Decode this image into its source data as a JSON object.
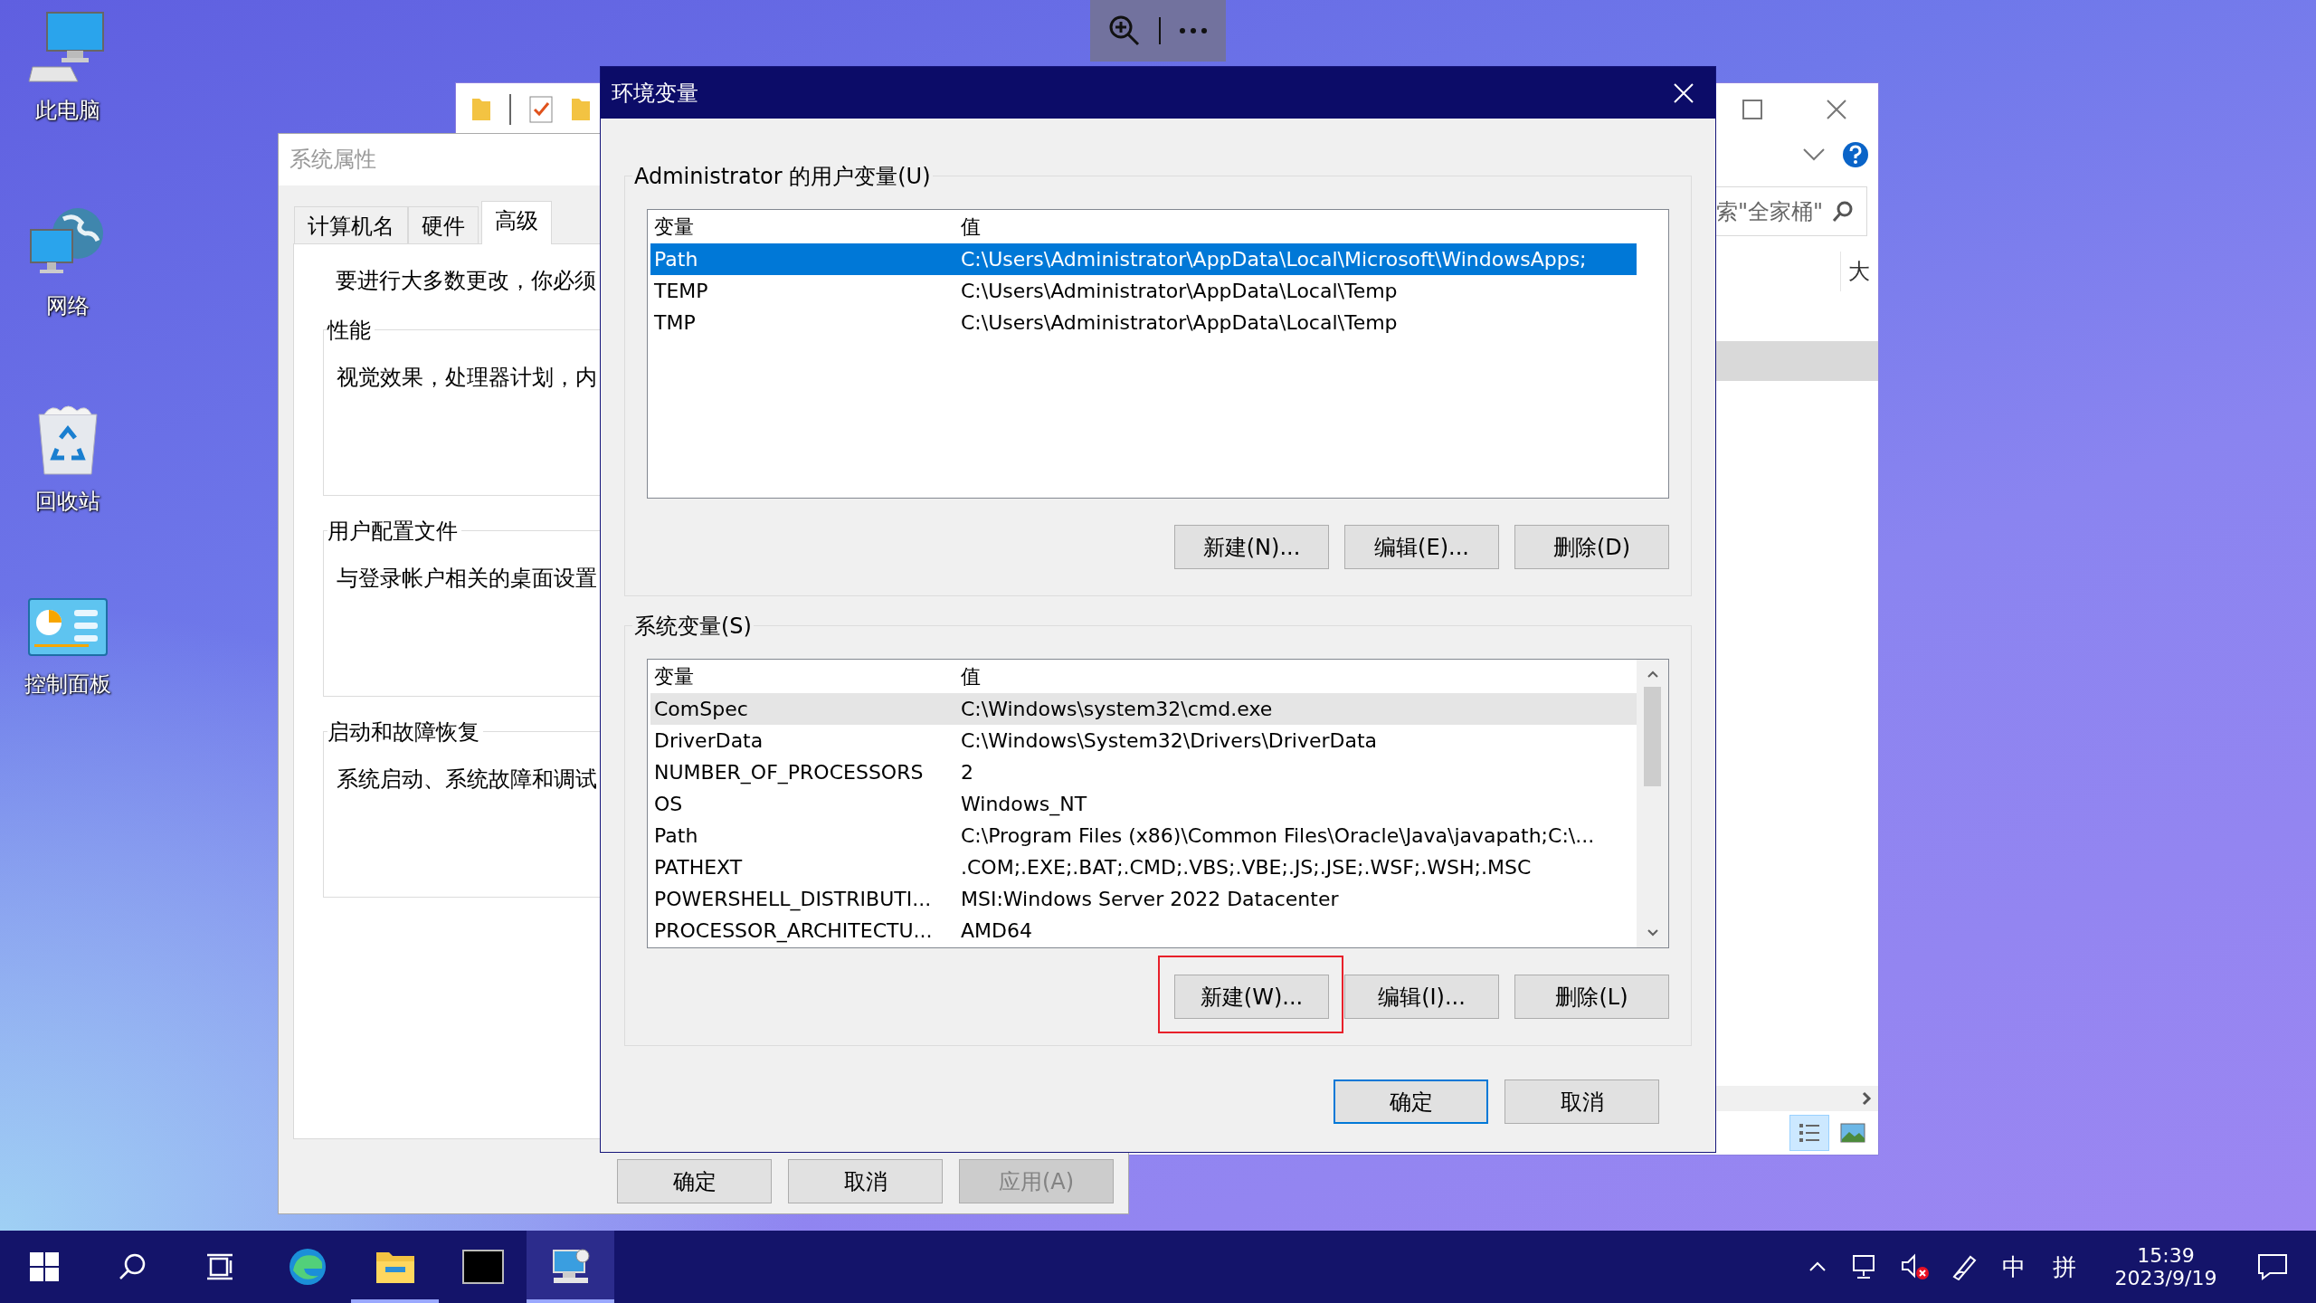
{
  "desktop_icons": [
    {
      "kind": "computer",
      "label": "此电脑"
    },
    {
      "kind": "network",
      "label": "网络"
    },
    {
      "kind": "recycle-bin",
      "label": "回收站"
    },
    {
      "kind": "control-panel",
      "label": "控制面板"
    }
  ],
  "explorer_window": {
    "search": {
      "placeholder": "索\"全家桶\""
    },
    "column_header": "大"
  },
  "system_properties": {
    "title": "系统属性",
    "tabs": [
      {
        "label": "计算机名",
        "selected": false
      },
      {
        "label": "硬件",
        "selected": false
      },
      {
        "label": "高级",
        "selected": true
      }
    ],
    "intro": "要进行大多数更改，你必须",
    "groups": [
      {
        "label": "性能",
        "text": "视觉效果，处理器计划，内"
      },
      {
        "label": "用户配置文件",
        "text": "与登录帐户相关的桌面设置"
      },
      {
        "label": "启动和故障恢复",
        "text": "系统启动、系统故障和调试"
      }
    ],
    "buttons": [
      {
        "label": "确定",
        "disabled": false
      },
      {
        "label": "取消",
        "disabled": false
      },
      {
        "label": "应用(A)",
        "disabled": true
      }
    ]
  },
  "env_dialog": {
    "title": "环境变量",
    "user_vars": {
      "label": "Administrator 的用户变量(U)",
      "focused": true,
      "columns": [
        "变量",
        "值"
      ],
      "rows": [
        {
          "name": "Path",
          "value": "C:\\Users\\Administrator\\AppData\\Local\\Microsoft\\WindowsApps;",
          "selected": true
        },
        {
          "name": "TEMP",
          "value": "C:\\Users\\Administrator\\AppData\\Local\\Temp",
          "selected": false
        },
        {
          "name": "TMP",
          "value": "C:\\Users\\Administrator\\AppData\\Local\\Temp",
          "selected": false
        }
      ],
      "buttons": [
        {
          "label": "新建(N)...",
          "highlighted": false
        },
        {
          "label": "编辑(E)...",
          "highlighted": false
        },
        {
          "label": "删除(D)",
          "highlighted": false
        }
      ]
    },
    "system_vars": {
      "label": "系统变量(S)",
      "focused": false,
      "columns": [
        "变量",
        "值"
      ],
      "rows": [
        {
          "name": "ComSpec",
          "value": "C:\\Windows\\system32\\cmd.exe",
          "selected": true
        },
        {
          "name": "DriverData",
          "value": "C:\\Windows\\System32\\Drivers\\DriverData",
          "selected": false
        },
        {
          "name": "NUMBER_OF_PROCESSORS",
          "value": "2",
          "selected": false
        },
        {
          "name": "OS",
          "value": "Windows_NT",
          "selected": false
        },
        {
          "name": "Path",
          "value": "C:\\Program Files (x86)\\Common Files\\Oracle\\Java\\javapath;C:\\...",
          "selected": false
        },
        {
          "name": "PATHEXT",
          "value": ".COM;.EXE;.BAT;.CMD;.VBS;.VBE;.JS;.JSE;.WSF;.WSH;.MSC",
          "selected": false
        },
        {
          "name": "POWERSHELL_DISTRIBUTI...",
          "value": "MSI:Windows Server 2022 Datacenter",
          "selected": false
        },
        {
          "name": "PROCESSOR_ARCHITECTU...",
          "value": "AMD64",
          "selected": false
        }
      ],
      "buttons": [
        {
          "label": "新建(W)...",
          "highlighted": true
        },
        {
          "label": "编辑(I)...",
          "highlighted": false
        },
        {
          "label": "删除(L)",
          "highlighted": false
        }
      ]
    },
    "buttons": [
      {
        "label": "确定",
        "default": true
      },
      {
        "label": "取消",
        "default": false
      }
    ]
  },
  "taskbar": {
    "apps": [
      {
        "kind": "edge",
        "running": false,
        "selected": false
      },
      {
        "kind": "file-explorer",
        "running": true,
        "selected": false
      },
      {
        "kind": "terminal",
        "running": false,
        "selected": false
      },
      {
        "kind": "system-properties",
        "running": true,
        "selected": true
      }
    ],
    "tray": {
      "input_mode": "中",
      "ime": "拼",
      "time": "15:39",
      "date": "2023/9/19"
    }
  }
}
